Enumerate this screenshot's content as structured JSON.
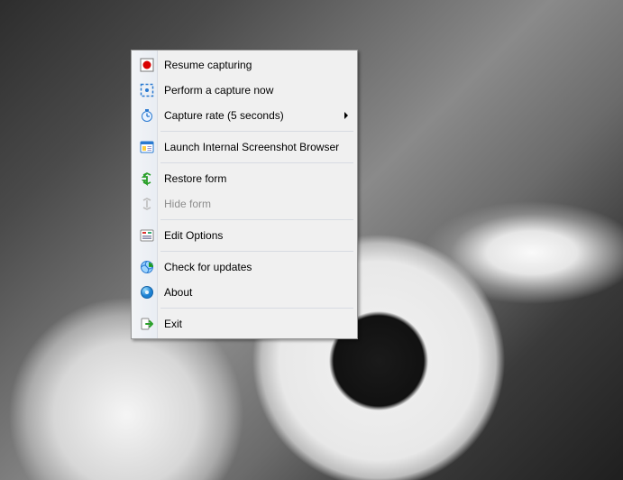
{
  "menu": {
    "items": [
      {
        "id": "resume",
        "label": "Resume capturing",
        "icon": "record-icon",
        "submenu": false,
        "enabled": true,
        "sepAfter": false
      },
      {
        "id": "perform",
        "label": "Perform a capture now",
        "icon": "capture-icon",
        "submenu": false,
        "enabled": true,
        "sepAfter": false
      },
      {
        "id": "rate",
        "label": "Capture rate (5 seconds)",
        "icon": "clock-icon",
        "submenu": true,
        "enabled": true,
        "sepAfter": true
      },
      {
        "id": "launch",
        "label": "Launch Internal Screenshot Browser",
        "icon": "browser-icon",
        "submenu": false,
        "enabled": true,
        "sepAfter": true
      },
      {
        "id": "restore",
        "label": "Restore form",
        "icon": "restore-icon",
        "submenu": false,
        "enabled": true,
        "sepAfter": false
      },
      {
        "id": "hide",
        "label": "Hide form",
        "icon": "hide-icon",
        "submenu": false,
        "enabled": false,
        "sepAfter": true
      },
      {
        "id": "options",
        "label": "Edit Options",
        "icon": "options-icon",
        "submenu": false,
        "enabled": true,
        "sepAfter": true
      },
      {
        "id": "updates",
        "label": "Check for updates",
        "icon": "updates-icon",
        "submenu": false,
        "enabled": true,
        "sepAfter": false
      },
      {
        "id": "about",
        "label": "About",
        "icon": "about-icon",
        "submenu": false,
        "enabled": true,
        "sepAfter": true
      },
      {
        "id": "exit",
        "label": "Exit",
        "icon": "exit-icon",
        "submenu": false,
        "enabled": true,
        "sepAfter": false
      }
    ]
  }
}
